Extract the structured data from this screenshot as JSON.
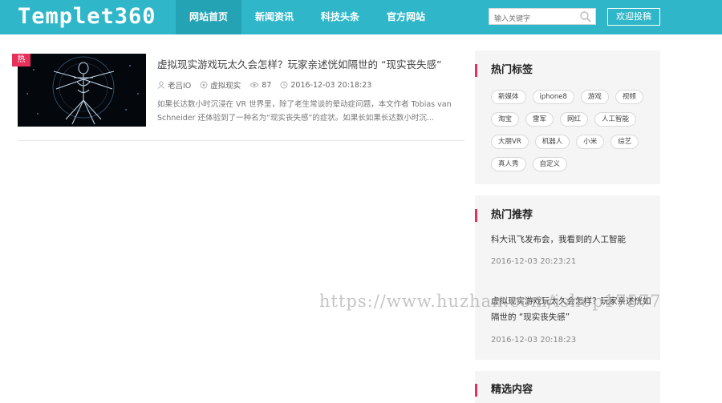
{
  "header": {
    "logo": "Templet360",
    "nav": [
      "网站首页",
      "新闻资讯",
      "科技头条",
      "官方网站"
    ],
    "search_placeholder": "输入关键字",
    "submit_label": "欢迎投稿"
  },
  "article": {
    "badge": "热",
    "title": "虚拟现实游戏玩太久会怎样？玩家亲述恍如隔世的 “现实丧失感”",
    "author": "老吕IO",
    "category": "虚拟现实",
    "views": "87",
    "date": "2016-12-03 20:18:23",
    "excerpt": "如果长达数小时沉浸在 VR 世界里，除了老生常谈的晕动症问题，本文作者 Tobias van Schneider 还体验到了一种名为“现实丧失感”的症状。如果长如果长达数小时沉..."
  },
  "sidebar": {
    "hot_tags": {
      "title": "热门标签",
      "tags": [
        "新媒体",
        "iphone8",
        "游戏",
        "视频",
        "淘宝",
        "雷军",
        "网红",
        "人工智能",
        "大朋VR",
        "机器人",
        "小米",
        "综艺",
        "真人秀",
        "自定义"
      ]
    },
    "hot_recommend": {
      "title": "热门推荐",
      "items": [
        {
          "title": "科大讯飞发布会，我看到的人工智能",
          "date": "2016-12-03 20:23:21"
        },
        {
          "title": "虚拟现实游戏玩太久会怎样？玩家亲述恍如隔世的 “现实丧失感”",
          "date": "2016-12-03 20:18:23"
        }
      ]
    },
    "featured": {
      "title": "精选内容"
    }
  },
  "watermark": "https://www.huzhan.com/ishop17577",
  "colors": {
    "header_bg": "#2fb7c9",
    "nav_active": "#24a3b5",
    "accent": "#e8305c",
    "sidebar_bg": "#f5f5f5"
  }
}
